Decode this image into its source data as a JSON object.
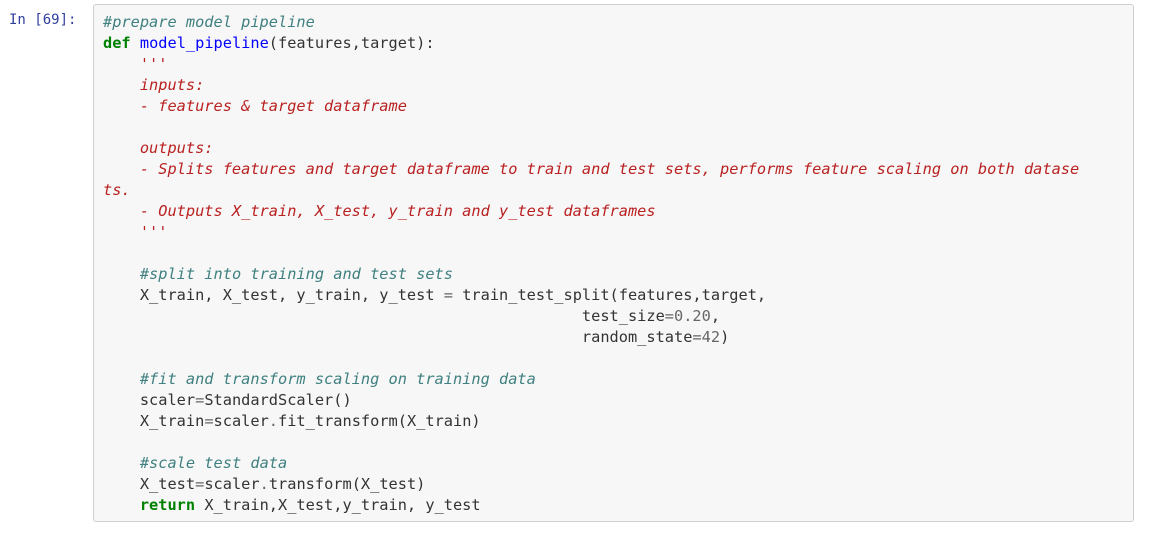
{
  "cell": {
    "prompt": "In [69]:",
    "lines": [
      [
        {
          "t": "#prepare model pipeline",
          "c": "cmt"
        }
      ],
      [
        {
          "t": "def",
          "c": "kw"
        },
        {
          "t": " ",
          "c": ""
        },
        {
          "t": "model_pipeline",
          "c": "fn"
        },
        {
          "t": "(features,target):",
          "c": ""
        }
      ],
      [
        {
          "t": "    '''",
          "c": "doc"
        }
      ],
      [
        {
          "t": "    inputs:",
          "c": "doc"
        }
      ],
      [
        {
          "t": "    - features & target dataframe",
          "c": "doc"
        }
      ],
      [
        {
          "t": "",
          "c": ""
        }
      ],
      [
        {
          "t": "    outputs:",
          "c": "doc"
        }
      ],
      [
        {
          "t": "    - Splits features and target dataframe to train and test sets, performs feature scaling on both datase",
          "c": "doc"
        }
      ],
      [
        {
          "t": "ts.",
          "c": "doc"
        }
      ],
      [
        {
          "t": "    - Outputs X_train, X_test, y_train and y_test dataframes",
          "c": "doc"
        }
      ],
      [
        {
          "t": "    '''",
          "c": "doc"
        }
      ],
      [
        {
          "t": "",
          "c": ""
        }
      ],
      [
        {
          "t": "    ",
          "c": ""
        },
        {
          "t": "#split into training and test sets",
          "c": "cmt"
        }
      ],
      [
        {
          "t": "    X_train, X_test, y_train, y_test ",
          "c": ""
        },
        {
          "t": "=",
          "c": "op"
        },
        {
          "t": " train_test_split(features,target,",
          "c": ""
        }
      ],
      [
        {
          "t": "                                                    test_size",
          "c": ""
        },
        {
          "t": "=",
          "c": "op"
        },
        {
          "t": "0.20",
          "c": "num"
        },
        {
          "t": ",",
          "c": ""
        }
      ],
      [
        {
          "t": "                                                    random_state",
          "c": ""
        },
        {
          "t": "=",
          "c": "op"
        },
        {
          "t": "42",
          "c": "num"
        },
        {
          "t": ")",
          "c": ""
        }
      ],
      [
        {
          "t": "",
          "c": ""
        }
      ],
      [
        {
          "t": "    ",
          "c": ""
        },
        {
          "t": "#fit and transform scaling on training data",
          "c": "cmt"
        }
      ],
      [
        {
          "t": "    scaler",
          "c": ""
        },
        {
          "t": "=",
          "c": "op"
        },
        {
          "t": "StandardScaler()",
          "c": ""
        }
      ],
      [
        {
          "t": "    X_train",
          "c": ""
        },
        {
          "t": "=",
          "c": "op"
        },
        {
          "t": "scaler",
          "c": ""
        },
        {
          "t": ".",
          "c": "op"
        },
        {
          "t": "fit_transform(X_train)",
          "c": ""
        }
      ],
      [
        {
          "t": "",
          "c": ""
        }
      ],
      [
        {
          "t": "    ",
          "c": ""
        },
        {
          "t": "#scale test data",
          "c": "cmt"
        }
      ],
      [
        {
          "t": "    X_test",
          "c": ""
        },
        {
          "t": "=",
          "c": "op"
        },
        {
          "t": "scaler",
          "c": ""
        },
        {
          "t": ".",
          "c": "op"
        },
        {
          "t": "transform(X_test)",
          "c": ""
        }
      ],
      [
        {
          "t": "    ",
          "c": ""
        },
        {
          "t": "return",
          "c": "kw"
        },
        {
          "t": " X_train,X_test,y_train, y_test",
          "c": ""
        }
      ]
    ]
  },
  "colors": {
    "comment": "#408080",
    "docstring": "#ba2121",
    "keyword": "#008000",
    "function_name": "#0000ff",
    "prompt": "#303f9f",
    "cell_background": "#f7f7f7",
    "cell_border": "#cfcfcf"
  }
}
